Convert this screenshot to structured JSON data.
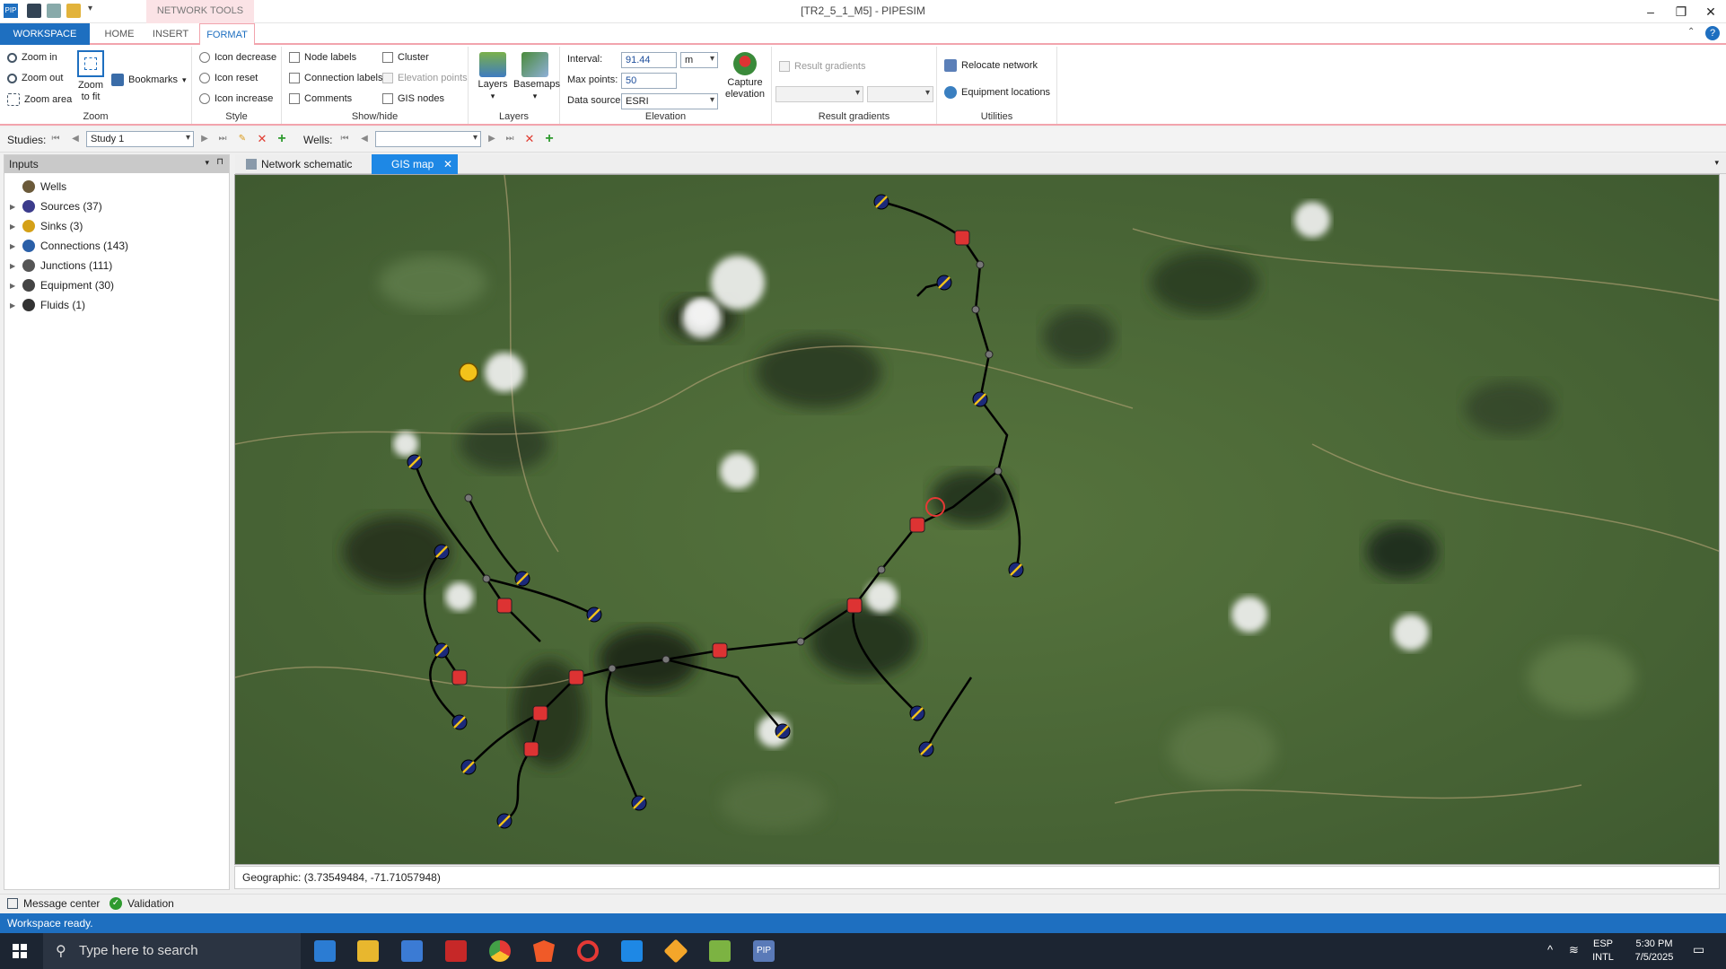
{
  "window": {
    "title": "[TR2_5_1_M5] - PIPESIM",
    "context_tab": "NETWORK TOOLS",
    "controls": {
      "minimize": "–",
      "restore": "❐",
      "close": "✕"
    }
  },
  "ribbon_tabs": [
    "WORKSPACE",
    "HOME",
    "INSERT",
    "FORMAT"
  ],
  "ribbon": {
    "zoom": {
      "label": "Zoom",
      "zoom_in": "Zoom in",
      "zoom_out": "Zoom out",
      "zoom_area": "Zoom area",
      "zoom_to_fit": "Zoom to fit",
      "bookmarks": "Bookmarks"
    },
    "style": {
      "label": "Style",
      "icon_decrease": "Icon decrease",
      "icon_reset": "Icon reset",
      "icon_increase": "Icon increase"
    },
    "showhide": {
      "label": "Show/hide",
      "node_labels": "Node labels",
      "connection_labels": "Connection labels",
      "comments": "Comments",
      "cluster": "Cluster",
      "elevation_points": "Elevation points",
      "gis_nodes": "GIS nodes"
    },
    "layers": {
      "label": "Layers",
      "layers": "Layers",
      "basemaps": "Basemaps"
    },
    "elevation": {
      "label": "Elevation",
      "interval_label": "Interval:",
      "interval_value": "91.44",
      "interval_unit": "m",
      "max_points_label": "Max points:",
      "max_points_value": "50",
      "data_source_label": "Data source:",
      "data_source_value": "ESRI",
      "capture": "Capture elevation"
    },
    "result_gradients": {
      "label": "Result gradients",
      "checkbox": "Result gradients"
    },
    "utilities": {
      "label": "Utilities",
      "relocate": "Relocate network",
      "equipment": "Equipment locations"
    }
  },
  "studies_bar": {
    "studies_label": "Studies:",
    "study_value": "Study 1",
    "wells_label": "Wells:",
    "wells_value": ""
  },
  "inputs_panel": {
    "title": "Inputs",
    "items": [
      {
        "label": "Wells",
        "expandable": false,
        "color": "#6b5a3a"
      },
      {
        "label": "Sources (37)",
        "expandable": true,
        "color": "#3c3c8c"
      },
      {
        "label": "Sinks (3)",
        "expandable": true,
        "color": "#d4a017"
      },
      {
        "label": "Connections (143)",
        "expandable": true,
        "color": "#2a5fa8"
      },
      {
        "label": "Junctions (111)",
        "expandable": true,
        "color": "#555555"
      },
      {
        "label": "Equipment (30)",
        "expandable": true,
        "color": "#444444"
      },
      {
        "label": "Fluids (1)",
        "expandable": true,
        "color": "#333333"
      }
    ]
  },
  "doc_tabs": [
    {
      "label": "Network schematic",
      "active": false
    },
    {
      "label": "GIS map",
      "active": true
    }
  ],
  "map": {
    "coord_text": "Geographic: (3.73549484, -71.71057948)"
  },
  "bottom_tabs": [
    "Message center",
    "Validation"
  ],
  "status": "Workspace ready.",
  "taskbar": {
    "search_placeholder": "Type here to search",
    "lang": "ESP",
    "lang2": "INTL",
    "time": "5:30 PM",
    "date": "7/5/2025"
  },
  "colors": {
    "accent": "#1e6fc0",
    "ribbon_border": "#f2a4ad",
    "map_ground": "#4b6b38"
  }
}
